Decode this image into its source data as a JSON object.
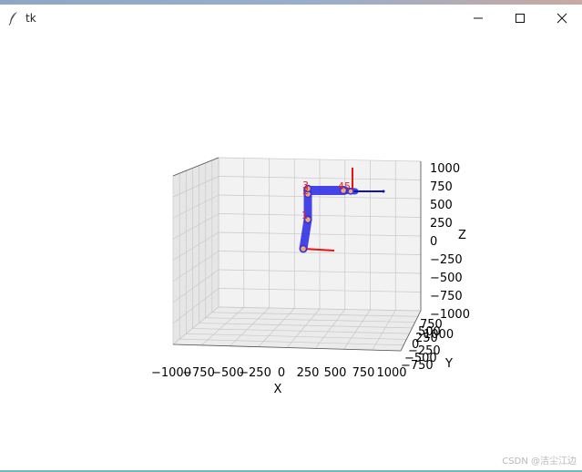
{
  "window": {
    "title": "tk"
  },
  "axes": {
    "xlabel": "X",
    "ylabel": "Y",
    "zlabel": "Z",
    "x_ticks": [
      "−1000",
      "−750",
      "−500",
      "−250",
      "0",
      "250",
      "500",
      "750",
      "1000"
    ],
    "y_ticks": [
      "−750",
      "−500",
      "−250",
      "0",
      "250",
      "500",
      "750",
      "1000"
    ],
    "z_ticks": [
      "1000",
      "750",
      "500",
      "250",
      "0",
      "−250",
      "−500",
      "−750",
      "−1000"
    ]
  },
  "joints": [
    "",
    "1",
    "2",
    "3",
    "4",
    "5"
  ],
  "colors": {
    "link": "#3333e6",
    "joint_fill": "#f5a86b",
    "axis_red": "#ee1111",
    "label": "#dd2222"
  },
  "watermark": "CSDN @洁尘江边"
}
